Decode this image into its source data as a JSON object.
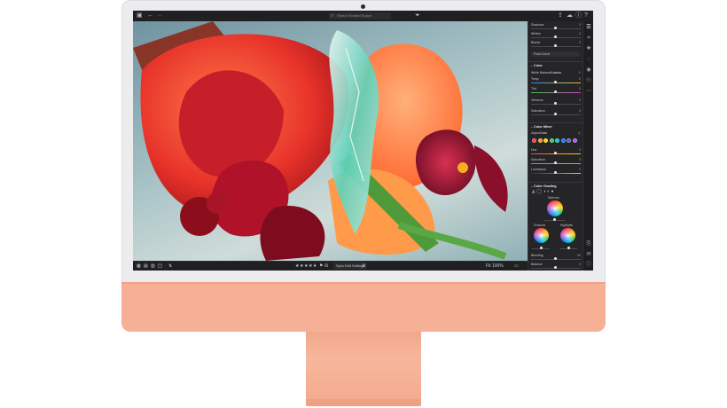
{
  "device": {
    "accent_color": "#f6b095",
    "stand_color": "#f3ab8f"
  },
  "topbar": {
    "search_placeholder": "Search Shared Space",
    "left_icons": [
      "sidebar-icon",
      "back-icon"
    ],
    "right_icons": [
      "share-icon",
      "cloud-icon",
      "info-icon",
      "help-icon"
    ]
  },
  "photo": {
    "subject": "flower-and-glass-sculpture"
  },
  "bottombar": {
    "rating": "★★★★★",
    "flag_text": "⚑ ☒",
    "sync_label": "Sync Edit Settings",
    "zoom_label": "Fit  100%",
    "left_view_icons": [
      "grid-view-icon",
      "square-grid-icon",
      "detail-view-icon",
      "loupe-view-icon",
      "sort-icon"
    ]
  },
  "panel": {
    "top_sliders": [
      {
        "label": "Shadows",
        "value": "0"
      },
      {
        "label": "Whites",
        "value": "0"
      },
      {
        "label": "Blacks",
        "value": "0"
      }
    ],
    "point_curve_label": "Point Curve",
    "color_section": {
      "title": "Color",
      "white_balance_label": "White Balance",
      "white_balance_value": "Custom",
      "sliders": [
        {
          "label": "Temp",
          "value": "0"
        },
        {
          "label": "Tint",
          "value": "0"
        },
        {
          "label": "Vibrance",
          "value": "0"
        },
        {
          "label": "Saturation",
          "value": "0"
        }
      ]
    },
    "color_mixer": {
      "title": "Color Mixer",
      "adjust_label": "Adjust",
      "adjust_value": "Color",
      "swatches": [
        "#ff3b30",
        "#ff9500",
        "#ffcc00",
        "#34c759",
        "#00c7be",
        "#007aff",
        "#5856d6",
        "#af52de"
      ],
      "sliders": [
        {
          "label": "Hue",
          "value": "0"
        },
        {
          "label": "Saturation",
          "value": "0"
        },
        {
          "label": "Luminance",
          "value": "0"
        }
      ]
    },
    "color_grading": {
      "title": "Color Grading",
      "midtones_label": "Midtones",
      "shadows_label": "Shadows",
      "highlights_label": "Highlights",
      "sliders": [
        {
          "label": "Blending",
          "value": "50"
        },
        {
          "label": "Balance",
          "value": "0"
        }
      ]
    }
  }
}
